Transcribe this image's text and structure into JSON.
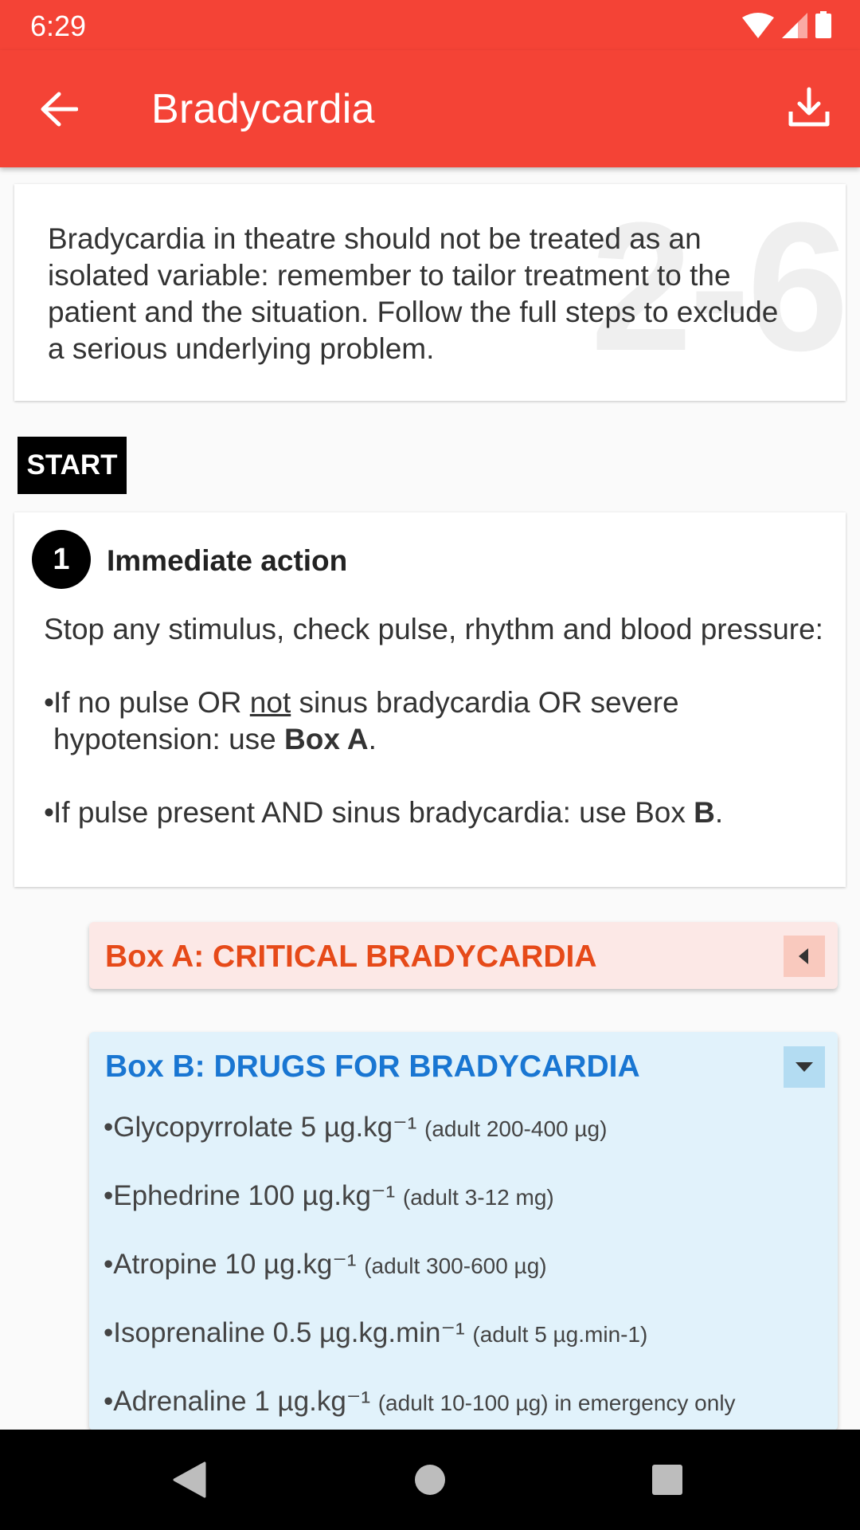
{
  "status": {
    "time": "6:29"
  },
  "appbar": {
    "title": "Bradycardia"
  },
  "intro": {
    "text": "Bradycardia in theatre should not be treated as an isolated variable: remember to tailor treatment to the patient and the situation. Follow the full steps to exclude a serious underlying problem.",
    "watermark": "2-6"
  },
  "start_label": "START",
  "step": {
    "number": "1",
    "title": "Immediate action",
    "intro": "Stop any stimulus, check pulse, rhythm and blood pressure:",
    "bullet1_pre": "If no pulse OR ",
    "bullet1_u": "not",
    "bullet1_mid": " sinus bradycardia OR severe hypotension: use ",
    "bullet1_bold": "Box A",
    "bullet1_end": ".",
    "bullet2_pre": "If pulse present AND sinus bradycardia: use Box ",
    "bullet2_bold": "B",
    "bullet2_end": "."
  },
  "boxA": {
    "title": "Box A: CRITICAL BRADYCARDIA",
    "state": "collapsed"
  },
  "boxB": {
    "title": "Box B: DRUGS FOR BRADYCARDIA",
    "state": "expanded",
    "drugs": [
      {
        "name": "Glycopyrrolate 5 µg.kg⁻¹",
        "note": "(adult 200-400 µg)"
      },
      {
        "name": "Ephedrine 100 µg.kg⁻¹",
        "note": "(adult 3-12 mg)"
      },
      {
        "name": "Atropine 10 µg.kg⁻¹",
        "note": "(adult 300-600 µg)"
      },
      {
        "name": "Isoprenaline 0.5 µg.kg.min⁻¹",
        "note": "(adult 5 µg.min-1)"
      },
      {
        "name": "Adrenaline 1 µg.kg⁻¹",
        "note": "(adult 10-100 µg) in emergency only"
      }
    ]
  },
  "colors": {
    "appbar": "#f44336",
    "boxA_text": "#e64a19",
    "boxB_text": "#1976d2"
  }
}
